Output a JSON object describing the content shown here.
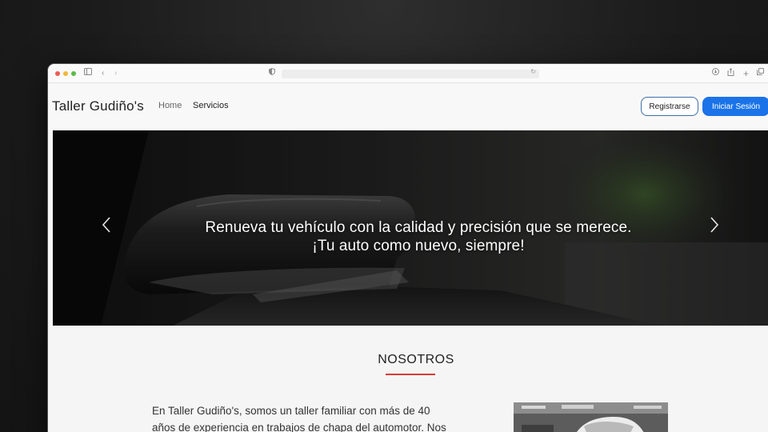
{
  "browser": {
    "url": "",
    "icons": {
      "sidebar": "sidebar-icon",
      "back": "chevron-left-icon",
      "forward": "chevron-right-icon",
      "shield": "shield-icon",
      "reload": "reload-icon",
      "download": "download-icon",
      "share": "share-icon",
      "new_tab": "plus-icon",
      "tabs": "tabs-icon"
    }
  },
  "nav": {
    "brand": "Taller Gudiño's",
    "links": [
      "Home",
      "Servicios"
    ],
    "register_label": "Registrarse",
    "login_label": "Iniciar Sesión"
  },
  "hero": {
    "caption_line1": "Renueva tu vehículo con la calidad y precisión que se merece.",
    "caption_line2": "¡Tu auto como nuevo, siempre!",
    "prev_icon": "chevron-left-icon",
    "next_icon": "chevron-right-icon"
  },
  "about": {
    "title": "NOSOTROS",
    "text_line1": "En Taller Gudiño's, somos un taller familiar con más de 40",
    "text_line2": "años de experiencia en trabajos de chapa del automotor. Nos"
  },
  "colors": {
    "accent": "#1a73e8",
    "underline": "#d93a34"
  }
}
